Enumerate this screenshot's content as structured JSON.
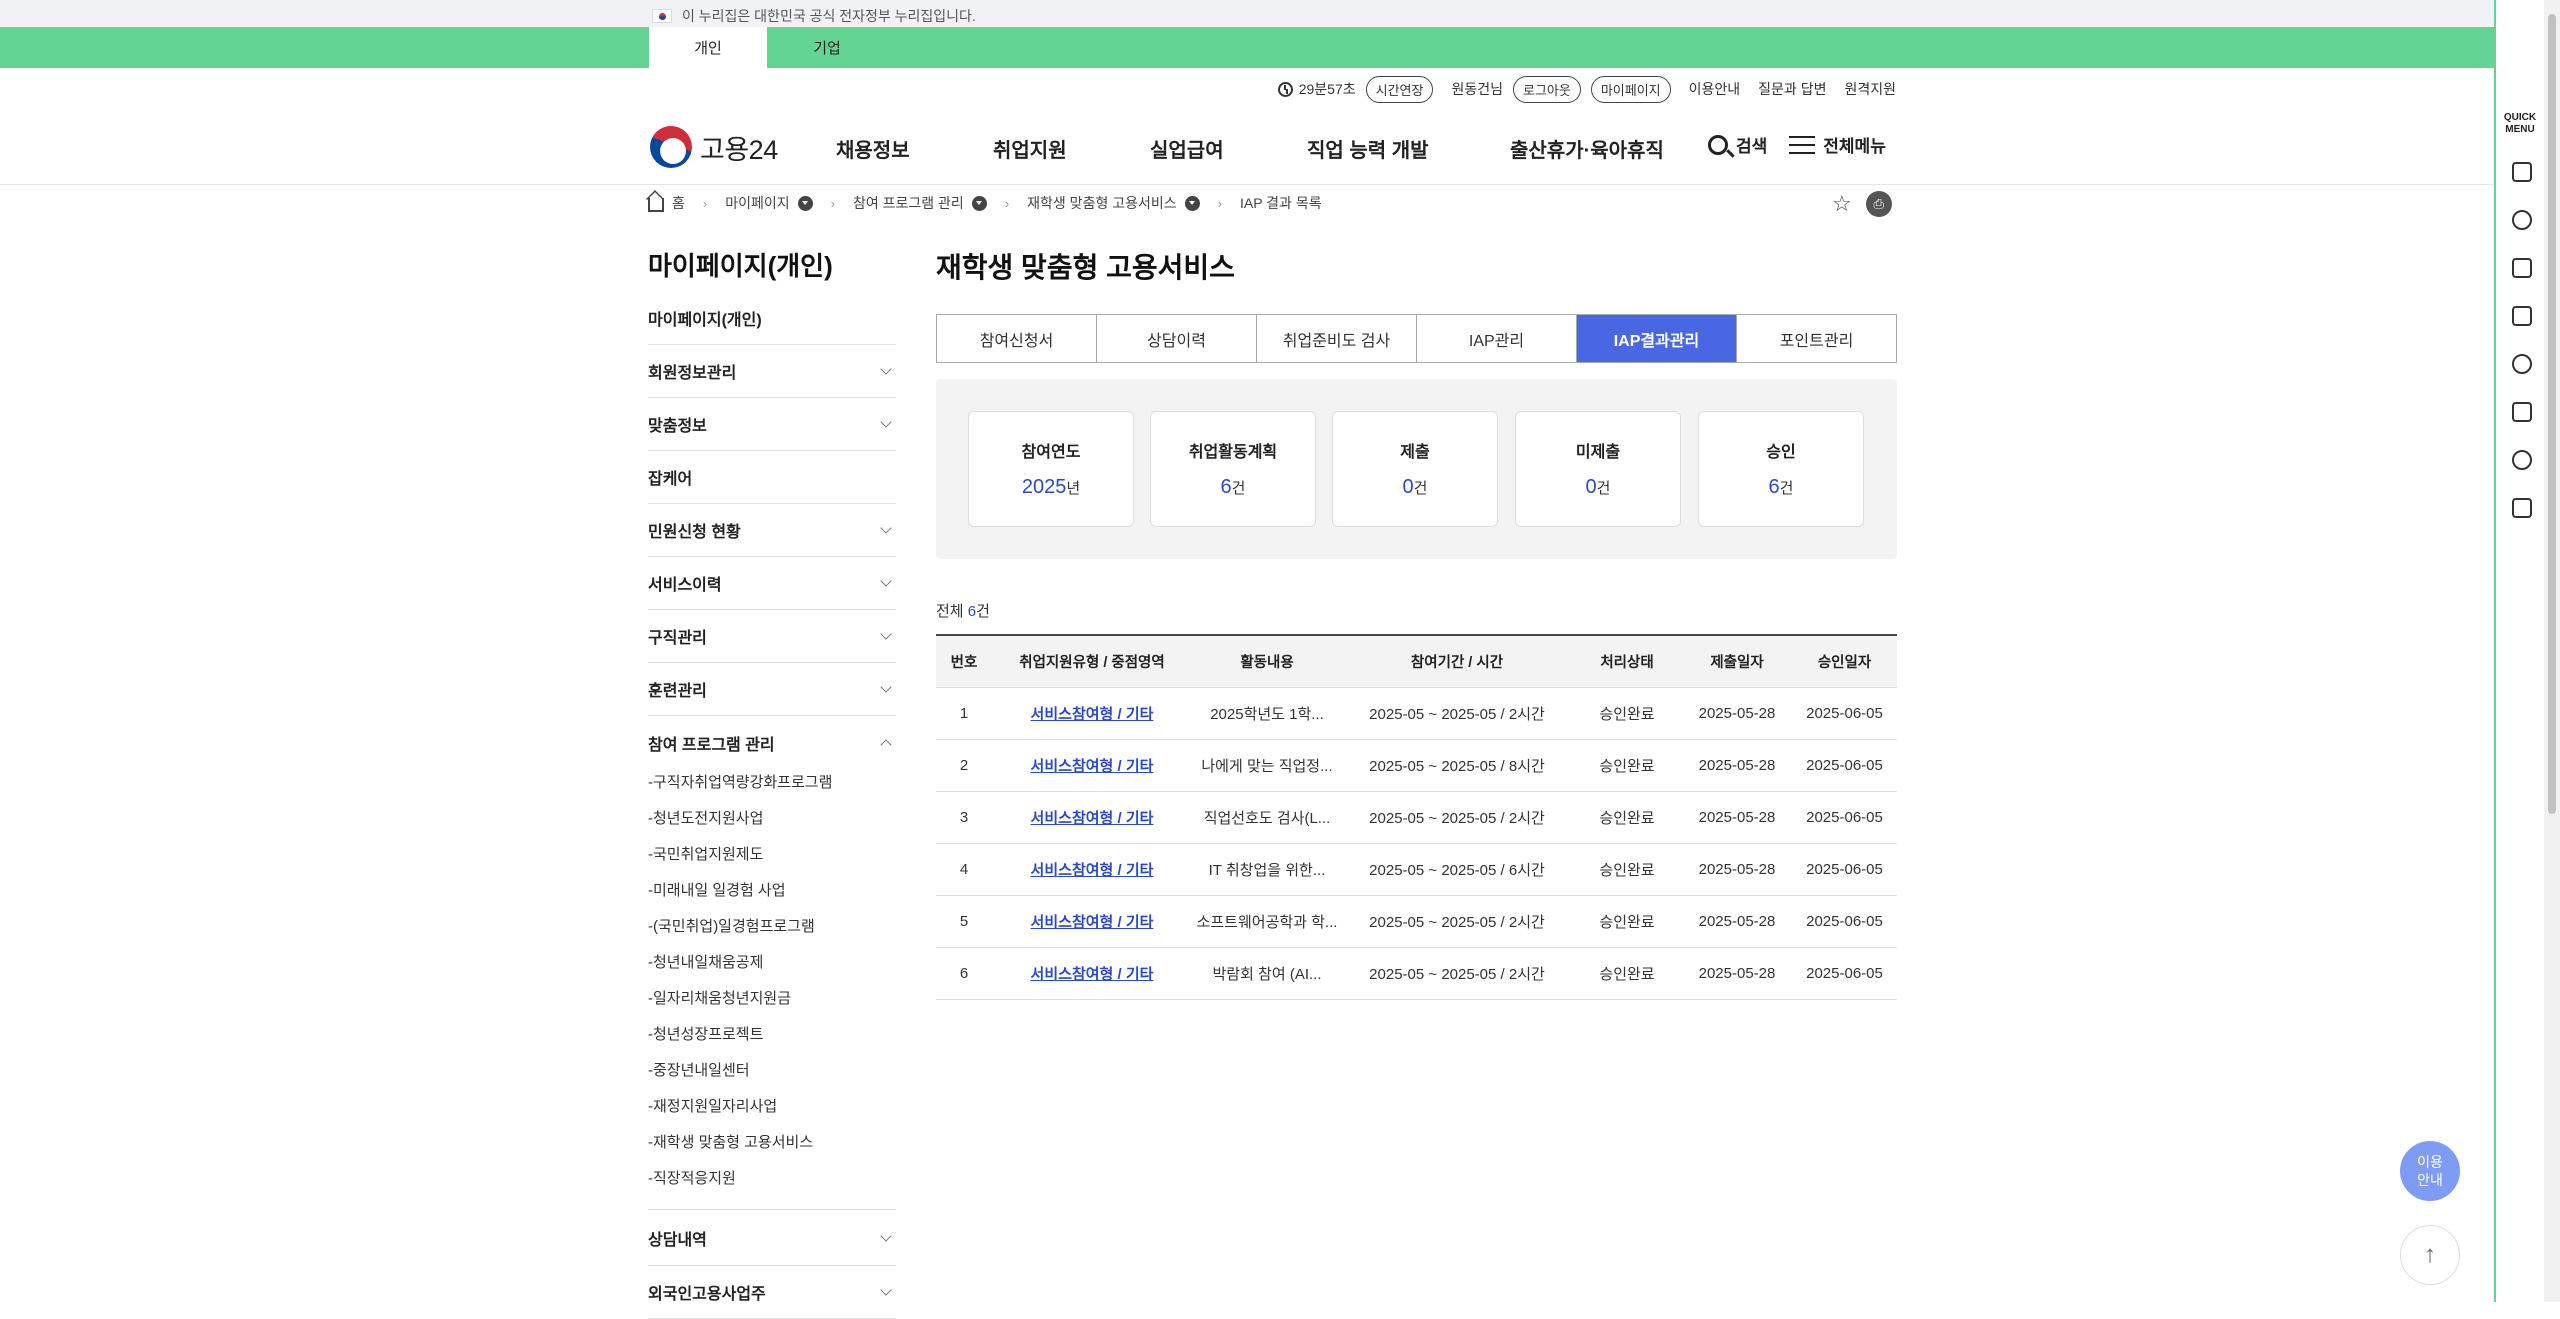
{
  "gov_banner": "이 누리집은 대한민국 공식 전자정부 누리집입니다.",
  "top_tabs": [
    "개인",
    "기업"
  ],
  "util": {
    "timer": "29분57초",
    "extend": "시간연장",
    "user": "원동건님",
    "logout": "로그아웃",
    "mypage": "마이페이지",
    "guide": "이용안내",
    "qna": "질문과 답변",
    "remote": "원격지원"
  },
  "logo": "고용24",
  "gnb": [
    "채용정보",
    "취업지원",
    "실업급여",
    "직업 능력 개발",
    "출산휴가·육아휴직"
  ],
  "header_right": {
    "search": "검색",
    "menu": "전체메뉴"
  },
  "breadcrumb": [
    "홈",
    "마이페이지",
    "참여 프로그램 관리",
    "재학생 맞춤형 고용서비스",
    "IAP 결과 목록"
  ],
  "lnb": {
    "title": "마이페이지(개인)",
    "items": [
      "마이페이지(개인)",
      "회원정보관리",
      "맞춤정보",
      "잡케어",
      "민원신청 현황",
      "서비스이력",
      "구직관리",
      "훈련관리",
      "참여 프로그램 관리"
    ],
    "sub": [
      "-구직자취업역량강화프로그램",
      "-청년도전지원사업",
      "-국민취업지원제도",
      "-미래내일 일경험 사업",
      "-(국민취업)일경험프로그램",
      "-청년내일채움공제",
      "-일자리채움청년지원금",
      "-청년성장프로젝트",
      "-중장년내일센터",
      "-재정지원일자리사업",
      "-재학생 맞춤형 고용서비스",
      "-직장적응지원"
    ],
    "after": [
      "상담내역",
      "외국인고용사업주"
    ]
  },
  "page_title": "재학생 맞춤형 고용서비스",
  "tabs": [
    "참여신청서",
    "상담이력",
    "취업준비도 검사",
    "IAP관리",
    "IAP결과관리",
    "포인트관리"
  ],
  "summary": [
    {
      "label": "참여연도",
      "value": "2025",
      "unit": "년"
    },
    {
      "label": "취업활동계획",
      "value": "6",
      "unit": "건"
    },
    {
      "label": "제출",
      "value": "0",
      "unit": "건"
    },
    {
      "label": "미제출",
      "value": "0",
      "unit": "건"
    },
    {
      "label": "승인",
      "value": "6",
      "unit": "건"
    }
  ],
  "total": {
    "prefix": "전체 ",
    "count": "6",
    "unit": "건"
  },
  "table": {
    "headers": [
      "번호",
      "취업지원유형 / 중점영역",
      "활동내용",
      "참여기간 / 시간",
      "처리상태",
      "제출일자",
      "승인일자"
    ],
    "rows": [
      [
        "1",
        "서비스참여형 / 기타",
        "2025학년도 1학...",
        "2025-05 ~ 2025-05 / 2시간",
        "승인완료",
        "2025-05-28",
        "2025-06-05"
      ],
      [
        "2",
        "서비스참여형 / 기타",
        "나에게 맞는 직업정...",
        "2025-05 ~ 2025-05 / 8시간",
        "승인완료",
        "2025-05-28",
        "2025-06-05"
      ],
      [
        "3",
        "서비스참여형 / 기타",
        "직업선호도 검사(L...",
        "2025-05 ~ 2025-05 / 2시간",
        "승인완료",
        "2025-05-28",
        "2025-06-05"
      ],
      [
        "4",
        "서비스참여형 / 기타",
        "IT 취창업을 위한...",
        "2025-05 ~ 2025-05 / 6시간",
        "승인완료",
        "2025-05-28",
        "2025-06-05"
      ],
      [
        "5",
        "서비스참여형 / 기타",
        "소프트웨어공학과 학...",
        "2025-05 ~ 2025-05 / 2시간",
        "승인완료",
        "2025-05-28",
        "2025-06-05"
      ],
      [
        "6",
        "서비스참여형 / 기타",
        "박람회 참여 (AI...",
        "2025-05 ~ 2025-05 / 2시간",
        "승인완료",
        "2025-05-28",
        "2025-06-05"
      ]
    ]
  },
  "quick_menu": {
    "title_line1": "QUICK",
    "title_line2": "MENU"
  },
  "fab_guide_l1": "이용",
  "fab_guide_l2": "안내",
  "fab_top": "↑",
  "colors": {
    "green": "#64d492",
    "accent": "#4a67e3",
    "link": "#2b49c9"
  }
}
